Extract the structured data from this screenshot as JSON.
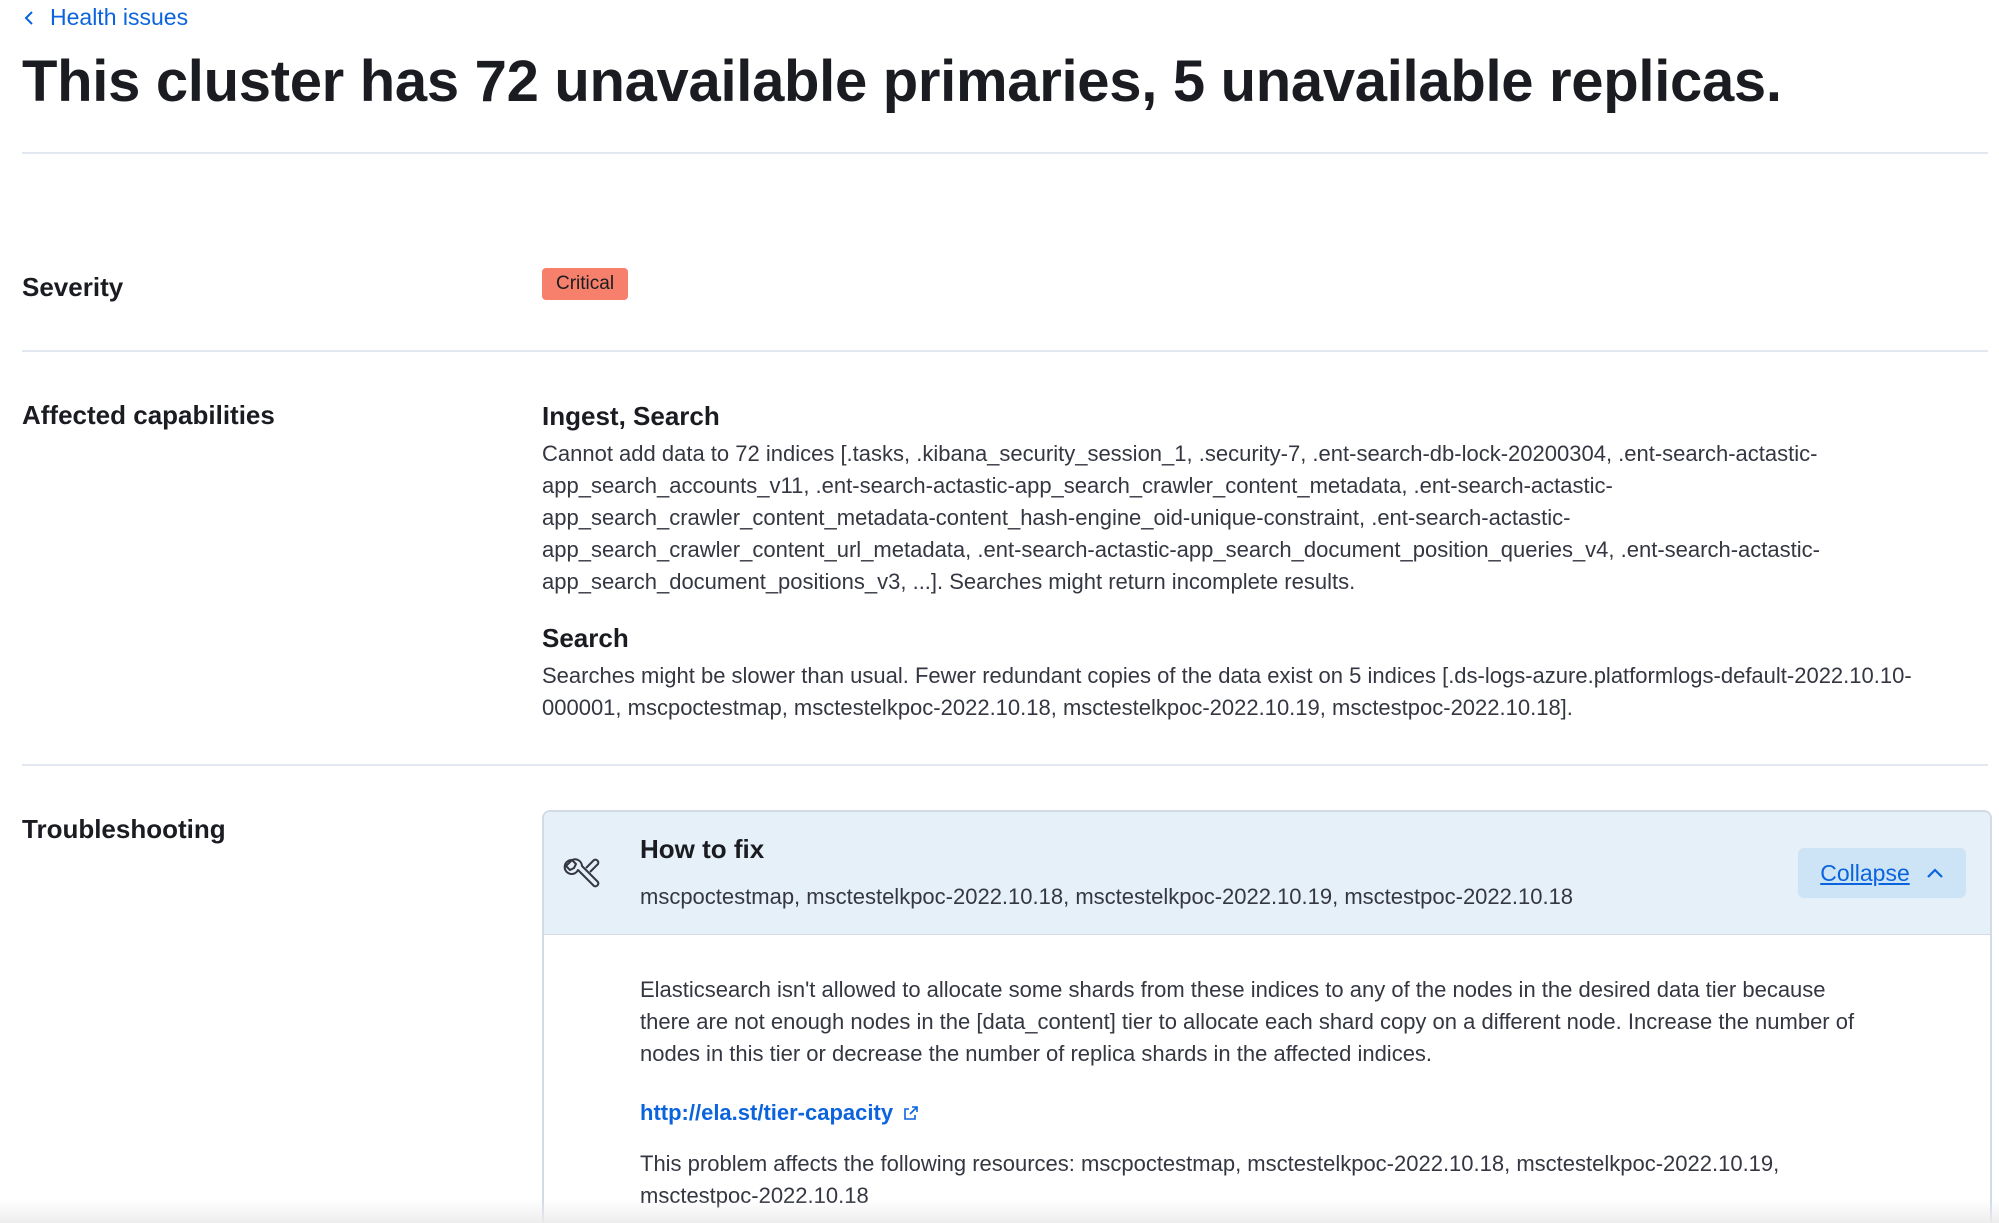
{
  "nav": {
    "back_label": "Health issues"
  },
  "header": {
    "title": "This cluster has 72 unavailable primaries, 5 unavailable replicas."
  },
  "severity": {
    "label": "Severity",
    "badge": "Critical",
    "badge_color": "#f6806b"
  },
  "affected": {
    "label": "Affected capabilities",
    "items": [
      {
        "title": "Ingest, Search",
        "description": "Cannot add data to 72 indices [.tasks, .kibana_security_session_1, .security-7, .ent-search-db-lock-20200304, .ent-search-actastic-app_search_accounts_v11, .ent-search-actastic-app_search_crawler_content_metadata, .ent-search-actastic-app_search_crawler_content_metadata-content_hash-engine_oid-unique-constraint, .ent-search-actastic-app_search_crawler_content_url_metadata, .ent-search-actastic-app_search_document_position_queries_v4, .ent-search-actastic-app_search_document_positions_v3, ...]. Searches might return incomplete results."
      },
      {
        "title": "Search",
        "description": "Searches might be slower than usual. Fewer redundant copies of the data exist on 5 indices [.ds-logs-azure.platformlogs-default-2022.10.10-000001, mscpoctestmap, msctestelkpoc-2022.10.18, msctestelkpoc-2022.10.19, msctestpoc-2022.10.18]."
      }
    ]
  },
  "troubleshooting": {
    "label": "Troubleshooting",
    "panel": {
      "icon": "wrench-icon",
      "title": "How to fix",
      "subtitle": "mscpoctestmap, msctestelkpoc-2022.10.18, msctestelkpoc-2022.10.19, msctestpoc-2022.10.18",
      "collapse_label": "Collapse",
      "body": "Elasticsearch isn't allowed to allocate some shards from these indices to any of the nodes in the desired data tier because there are not enough nodes in the [data_content] tier to allocate each shard copy on a different node. Increase the number of nodes in this tier or decrease the number of replica shards in the affected indices.",
      "link": "http://ela.st/tier-capacity",
      "resources": "This problem affects the following resources: mscpoctestmap, msctestelkpoc-2022.10.18, msctestelkpoc-2022.10.19, msctestpoc-2022.10.18"
    }
  },
  "colors": {
    "link": "#0b64dd",
    "panel_header_bg": "#e6f0f8",
    "collapse_bg": "#cce4f5",
    "divider": "#e3e8f0"
  }
}
